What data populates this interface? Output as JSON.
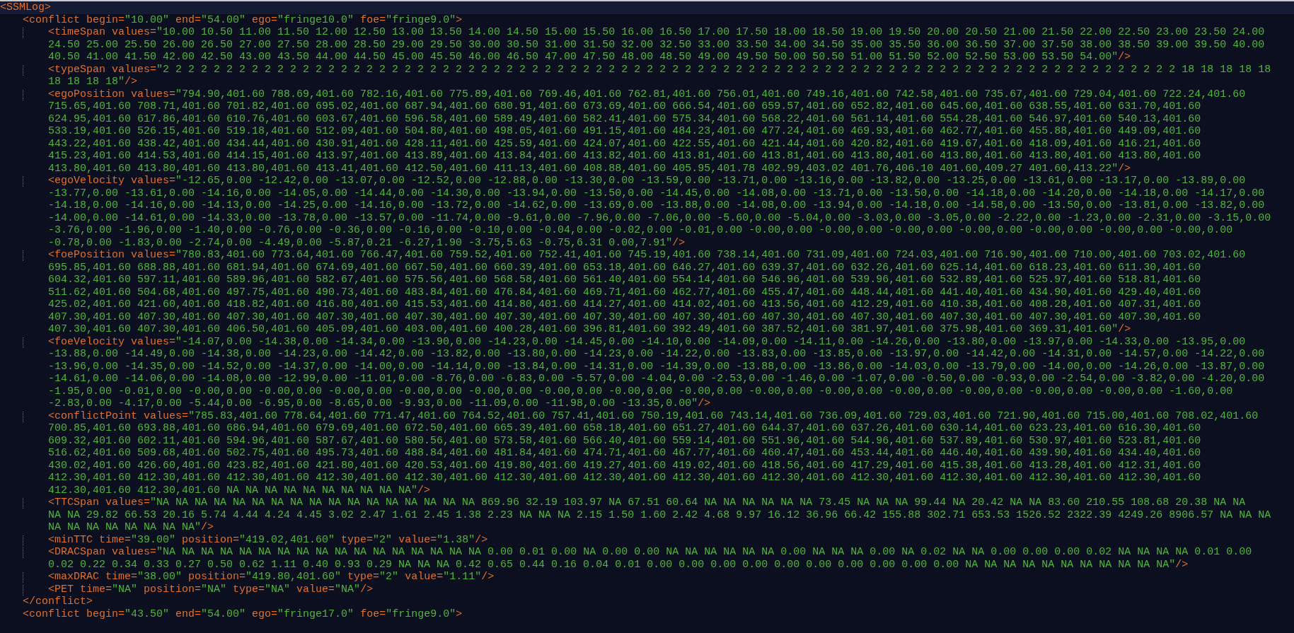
{
  "editor": {
    "root": {
      "current": true,
      "open": [
        {
          "kind": "tag",
          "text": "<SSMLog>"
        }
      ],
      "conflicts": [
        {
          "open": [
            {
              "kind": "tag",
              "text": "<conflict begin="
            },
            {
              "kind": "value",
              "text": "\"10.00\""
            },
            {
              "kind": "tag",
              "text": " end="
            },
            {
              "kind": "value",
              "text": "\"54.00\""
            },
            {
              "kind": "tag",
              "text": " ego="
            },
            {
              "kind": "value",
              "text": "\"fringe10.0\""
            },
            {
              "kind": "tag",
              "text": " foe="
            },
            {
              "kind": "value",
              "text": "\"fringe9.0\""
            },
            {
              "kind": "tag",
              "text": ">"
            }
          ],
          "elements": [
            {
              "lines": [
                [
                  {
                    "kind": "tag",
                    "text": "<timeSpan values="
                  },
                  {
                    "kind": "value",
                    "text": "\"10.00 10.50 11.00 11.50 12.00 12.50 13.00 13.50 14.00 14.50 15.00 15.50 16.00 16.50 17.00 17.50 18.00 18.50 19.00 19.50 20.00 20.50 21.00 21.50 22.00 22.50 23.00 23.50 24.00"
                  }
                ],
                [
                  {
                    "kind": "value",
                    "text": "24.50 25.00 25.50 26.00 26.50 27.00 27.50 28.00 28.50 29.00 29.50 30.00 30.50 31.00 31.50 32.00 32.50 33.00 33.50 34.00 34.50 35.00 35.50 36.00 36.50 37.00 37.50 38.00 38.50 39.00 39.50 40.00"
                  }
                ],
                [
                  {
                    "kind": "value",
                    "text": "40.50 41.00 41.50 42.00 42.50 43.00 43.50 44.00 44.50 45.00 45.50 46.00 46.50 47.00 47.50 48.00 48.50 49.00 49.50 50.00 50.50 51.00 51.50 52.00 52.50 53.00 53.50 54.00\""
                  },
                  {
                    "kind": "tag",
                    "text": "/>"
                  }
                ]
              ]
            },
            {
              "lines": [
                [
                  {
                    "kind": "tag",
                    "text": "<typeSpan values="
                  },
                  {
                    "kind": "value",
                    "text": "\"2 2 2 2 2 2 2 2 2 2 2 2 2 2 2 2 2 2 2 2 2 2 2 2 2 2 2 2 2 2 2 2 2 2 2 2 2 2 2 2 2 2 2 2 2 2 2 2 2 2 2 2 2 2 2 2 2 2 2 2 2 2 2 2 2 2 2 2 2 2 2 2 2 2 2 2 2 2 2 2 18 18 18 18 18"
                  }
                ],
                [
                  {
                    "kind": "value",
                    "text": "18 18 18 18\""
                  },
                  {
                    "kind": "tag",
                    "text": "/>"
                  }
                ]
              ]
            },
            {
              "lines": [
                [
                  {
                    "kind": "tag",
                    "text": "<egoPosition values="
                  },
                  {
                    "kind": "value",
                    "text": "\"794.90,401.60 788.69,401.60 782.16,401.60 775.89,401.60 769.46,401.60 762.81,401.60 756.01,401.60 749.16,401.60 742.58,401.60 735.67,401.60 729.04,401.60 722.24,401.60"
                  }
                ],
                [
                  {
                    "kind": "value",
                    "text": "715.65,401.60 708.71,401.60 701.82,401.60 695.02,401.60 687.94,401.60 680.91,401.60 673.69,401.60 666.54,401.60 659.57,401.60 652.82,401.60 645.60,401.60 638.55,401.60 631.70,401.60"
                  }
                ],
                [
                  {
                    "kind": "value",
                    "text": "624.95,401.60 617.86,401.60 610.76,401.60 603.67,401.60 596.58,401.60 589.49,401.60 582.41,401.60 575.34,401.60 568.22,401.60 561.14,401.60 554.28,401.60 546.97,401.60 540.13,401.60"
                  }
                ],
                [
                  {
                    "kind": "value",
                    "text": "533.19,401.60 526.15,401.60 519.18,401.60 512.09,401.60 504.80,401.60 498.05,401.60 491.15,401.60 484.23,401.60 477.24,401.60 469.93,401.60 462.77,401.60 455.88,401.60 449.09,401.60"
                  }
                ],
                [
                  {
                    "kind": "value",
                    "text": "443.22,401.60 438.42,401.60 434.44,401.60 430.91,401.60 428.11,401.60 425.59,401.60 424.07,401.60 422.55,401.60 421.44,401.60 420.82,401.60 419.67,401.60 418.09,401.60 416.21,401.60"
                  }
                ],
                [
                  {
                    "kind": "value",
                    "text": "415.23,401.60 414.53,401.60 414.15,401.60 413.97,401.60 413.89,401.60 413.84,401.60 413.82,401.60 413.81,401.60 413.81,401.60 413.80,401.60 413.80,401.60 413.80,401.60 413.80,401.60"
                  }
                ],
                [
                  {
                    "kind": "value",
                    "text": "413.80,401.60 413.80,401.60 413.80,401.60 413.41,401.60 412.50,401.60 411.13,401.60 408.88,401.60 405.95,401.78 402.99,403.02 401.76,406.10 401.60,409.27 401.60,413.22\""
                  },
                  {
                    "kind": "tag",
                    "text": "/>"
                  }
                ]
              ]
            },
            {
              "lines": [
                [
                  {
                    "kind": "tag",
                    "text": "<egoVelocity values="
                  },
                  {
                    "kind": "value",
                    "text": "\"-12.65,0.00 -12.42,0.00 -13.07,0.00 -12.52,0.00 -12.88,0.00 -13.30,0.00 -13.59,0.00 -13.71,0.00 -13.16,0.00 -13.82,0.00 -13.25,0.00 -13.61,0.00 -13.17,0.00 -13.89,0.00"
                  }
                ],
                [
                  {
                    "kind": "value",
                    "text": "-13.77,0.00 -13.61,0.00 -14.16,0.00 -14.05,0.00 -14.44,0.00 -14.30,0.00 -13.94,0.00 -13.50,0.00 -14.45,0.00 -14.08,0.00 -13.71,0.00 -13.50,0.00 -14.18,0.00 -14.20,0.00 -14.18,0.00 -14.17,0.00"
                  }
                ],
                [
                  {
                    "kind": "value",
                    "text": "-14.18,0.00 -14.16,0.00 -14.13,0.00 -14.25,0.00 -14.16,0.00 -13.72,0.00 -14.62,0.00 -13.69,0.00 -13.88,0.00 -14.08,0.00 -13.94,0.00 -14.18,0.00 -14.58,0.00 -13.50,0.00 -13.81,0.00 -13.82,0.00"
                  }
                ],
                [
                  {
                    "kind": "value",
                    "text": "-14.00,0.00 -14.61,0.00 -14.33,0.00 -13.78,0.00 -13.57,0.00 -11.74,0.00 -9.61,0.00 -7.96,0.00 -7.06,0.00 -5.60,0.00 -5.04,0.00 -3.03,0.00 -3.05,0.00 -2.22,0.00 -1.23,0.00 -2.31,0.00 -3.15,0.00"
                  }
                ],
                [
                  {
                    "kind": "value",
                    "text": "-3.76,0.00 -1.96,0.00 -1.40,0.00 -0.76,0.00 -0.36,0.00 -0.16,0.00 -0.10,0.00 -0.04,0.00 -0.02,0.00 -0.01,0.00 -0.00,0.00 -0.00,0.00 -0.00,0.00 -0.00,0.00 -0.00,0.00 -0.00,0.00 -0.00,0.00"
                  }
                ],
                [
                  {
                    "kind": "value",
                    "text": "-0.78,0.00 -1.83,0.00 -2.74,0.00 -4.49,0.00 -5.87,0.21 -6.27,1.90 -3.75,5.63 -0.75,6.31 0.00,7.91\""
                  },
                  {
                    "kind": "tag",
                    "text": "/>"
                  }
                ]
              ]
            },
            {
              "lines": [
                [
                  {
                    "kind": "tag",
                    "text": "<foePosition values="
                  },
                  {
                    "kind": "value",
                    "text": "\"780.83,401.60 773.64,401.60 766.47,401.60 759.52,401.60 752.41,401.60 745.19,401.60 738.14,401.60 731.09,401.60 724.03,401.60 716.90,401.60 710.00,401.60 703.02,401.60"
                  }
                ],
                [
                  {
                    "kind": "value",
                    "text": "695.85,401.60 688.88,401.60 681.94,401.60 674.69,401.60 667.50,401.60 660.39,401.60 653.18,401.60 646.27,401.60 639.37,401.60 632.26,401.60 625.14,401.60 618.23,401.60 611.30,401.60"
                  }
                ],
                [
                  {
                    "kind": "value",
                    "text": "604.32,401.60 597.11,401.60 589.96,401.60 582.67,401.60 575.56,401.60 568.58,401.60 561.40,401.60 554.14,401.60 546.96,401.60 539.96,401.60 532.89,401.60 525.97,401.60 518.81,401.60"
                  }
                ],
                [
                  {
                    "kind": "value",
                    "text": "511.62,401.60 504.68,401.60 497.75,401.60 490.73,401.60 483.84,401.60 476.84,401.60 469.71,401.60 462.77,401.60 455.47,401.60 448.44,401.60 441.40,401.60 434.90,401.60 429.40,401.60"
                  }
                ],
                [
                  {
                    "kind": "value",
                    "text": "425.02,401.60 421.60,401.60 418.82,401.60 416.80,401.60 415.53,401.60 414.80,401.60 414.27,401.60 414.02,401.60 413.56,401.60 412.29,401.60 410.38,401.60 408.28,401.60 407.31,401.60"
                  }
                ],
                [
                  {
                    "kind": "value",
                    "text": "407.30,401.60 407.30,401.60 407.30,401.60 407.30,401.60 407.30,401.60 407.30,401.60 407.30,401.60 407.30,401.60 407.30,401.60 407.30,401.60 407.30,401.60 407.30,401.60 407.30,401.60"
                  }
                ],
                [
                  {
                    "kind": "value",
                    "text": "407.30,401.60 407.30,401.60 406.50,401.60 405.09,401.60 403.00,401.60 400.28,401.60 396.81,401.60 392.49,401.60 387.52,401.60 381.97,401.60 375.98,401.60 369.31,401.60\""
                  },
                  {
                    "kind": "tag",
                    "text": "/>"
                  }
                ]
              ]
            },
            {
              "lines": [
                [
                  {
                    "kind": "tag",
                    "text": "<foeVelocity values="
                  },
                  {
                    "kind": "value",
                    "text": "\"-14.07,0.00 -14.38,0.00 -14.34,0.00 -13.90,0.00 -14.23,0.00 -14.45,0.00 -14.10,0.00 -14.09,0.00 -14.11,0.00 -14.26,0.00 -13.80,0.00 -13.97,0.00 -14.33,0.00 -13.95,0.00"
                  }
                ],
                [
                  {
                    "kind": "value",
                    "text": "-13.88,0.00 -14.49,0.00 -14.38,0.00 -14.23,0.00 -14.42,0.00 -13.82,0.00 -13.80,0.00 -14.23,0.00 -14.22,0.00 -13.83,0.00 -13.85,0.00 -13.97,0.00 -14.42,0.00 -14.31,0.00 -14.57,0.00 -14.22,0.00"
                  }
                ],
                [
                  {
                    "kind": "value",
                    "text": "-13.96,0.00 -14.35,0.00 -14.52,0.00 -14.37,0.00 -14.00,0.00 -14.14,0.00 -13.84,0.00 -14.31,0.00 -14.39,0.00 -13.88,0.00 -13.86,0.00 -14.03,0.00 -13.79,0.00 -14.00,0.00 -14.26,0.00 -13.87,0.00"
                  }
                ],
                [
                  {
                    "kind": "value",
                    "text": "-14.61,0.00 -14.06,0.00 -14.08,0.00 -12.99,0.00 -11.01,0.00 -8.76,0.00 -6.83,0.00 -5.57,0.00 -4.04,0.00 -2.53,0.00 -1.46,0.00 -1.07,0.00 -0.50,0.00 -0.93,0.00 -2.54,0.00 -3.82,0.00 -4.20,0.00"
                  }
                ],
                [
                  {
                    "kind": "value",
                    "text": "-1.95,0.00 -0.01,0.00 -0.00,0.00 -0.00,0.00 -0.00,0.00 -0.00,0.00 -0.00,0.00 -0.00,0.00 -0.00,0.00 -0.00,0.00 -0.00,0.00 -0.00,0.00 -0.00,0.00 -0.00,0.00 -0.00,0.00 -0.00,0.00 -1.60,0.00"
                  }
                ],
                [
                  {
                    "kind": "value",
                    "text": "-2.83,0.00 -4.17,0.00 -5.44,0.00 -6.95,0.00 -8.65,0.00 -9.93,0.00 -11.09,0.00 -11.98,0.00 -13.35,0.00\""
                  },
                  {
                    "kind": "tag",
                    "text": "/>"
                  }
                ]
              ]
            },
            {
              "lines": [
                [
                  {
                    "kind": "tag",
                    "text": "<conflictPoint values="
                  },
                  {
                    "kind": "value",
                    "text": "\"785.83,401.60 778.64,401.60 771.47,401.60 764.52,401.60 757.41,401.60 750.19,401.60 743.14,401.60 736.09,401.60 729.03,401.60 721.90,401.60 715.00,401.60 708.02,401.60"
                  }
                ],
                [
                  {
                    "kind": "value",
                    "text": "700.85,401.60 693.88,401.60 686.94,401.60 679.69,401.60 672.50,401.60 665.39,401.60 658.18,401.60 651.27,401.60 644.37,401.60 637.26,401.60 630.14,401.60 623.23,401.60 616.30,401.60"
                  }
                ],
                [
                  {
                    "kind": "value",
                    "text": "609.32,401.60 602.11,401.60 594.96,401.60 587.67,401.60 580.56,401.60 573.58,401.60 566.40,401.60 559.14,401.60 551.96,401.60 544.96,401.60 537.89,401.60 530.97,401.60 523.81,401.60"
                  }
                ],
                [
                  {
                    "kind": "value",
                    "text": "516.62,401.60 509.68,401.60 502.75,401.60 495.73,401.60 488.84,401.60 481.84,401.60 474.71,401.60 467.77,401.60 460.47,401.60 453.44,401.60 446.40,401.60 439.90,401.60 434.40,401.60"
                  }
                ],
                [
                  {
                    "kind": "value",
                    "text": "430.02,401.60 426.60,401.60 423.82,401.60 421.80,401.60 420.53,401.60 419.80,401.60 419.27,401.60 419.02,401.60 418.56,401.60 417.29,401.60 415.38,401.60 413.28,401.60 412.31,401.60"
                  }
                ],
                [
                  {
                    "kind": "value",
                    "text": "412.30,401.60 412.30,401.60 412.30,401.60 412.30,401.60 412.30,401.60 412.30,401.60 412.30,401.60 412.30,401.60 412.30,401.60 412.30,401.60 412.30,401.60 412.30,401.60 412.30,401.60"
                  }
                ],
                [
                  {
                    "kind": "value",
                    "text": "412.30,401.60 412.30,401.60 NA NA NA NA NA NA NA NA NA NA\""
                  },
                  {
                    "kind": "tag",
                    "text": "/>"
                  }
                ]
              ]
            },
            {
              "lines": [
                [
                  {
                    "kind": "tag",
                    "text": "<TTCSpan values="
                  },
                  {
                    "kind": "value",
                    "text": "\"NA NA NA NA NA NA NA NA NA NA NA NA NA NA NA NA NA 869.96 32.19 103.97 NA 67.51 60.64 NA NA NA NA NA NA 73.45 NA NA NA 99.44 NA 20.42 NA NA 83.60 210.55 108.68 20.38 NA NA"
                  }
                ],
                [
                  {
                    "kind": "value",
                    "text": "NA NA 29.82 66.53 20.16 5.74 4.44 4.24 4.45 3.02 2.47 1.61 2.45 1.38 2.23 NA NA NA 2.15 1.50 1.60 2.42 4.68 9.97 16.12 36.96 66.42 155.88 302.71 653.53 1526.52 2322.39 4249.26 8906.57 NA NA NA"
                  }
                ],
                [
                  {
                    "kind": "value",
                    "text": "NA NA NA NA NA NA NA NA\""
                  },
                  {
                    "kind": "tag",
                    "text": "/>"
                  }
                ]
              ]
            },
            {
              "lines": [
                [
                  {
                    "kind": "tag",
                    "text": "<minTTC time="
                  },
                  {
                    "kind": "value",
                    "text": "\"39.00\""
                  },
                  {
                    "kind": "tag",
                    "text": " position="
                  },
                  {
                    "kind": "value",
                    "text": "\"419.02,401.60\""
                  },
                  {
                    "kind": "tag",
                    "text": " type="
                  },
                  {
                    "kind": "value",
                    "text": "\"2\""
                  },
                  {
                    "kind": "tag",
                    "text": " value="
                  },
                  {
                    "kind": "value",
                    "text": "\"1.38\""
                  },
                  {
                    "kind": "tag",
                    "text": "/>"
                  }
                ]
              ]
            },
            {
              "lines": [
                [
                  {
                    "kind": "tag",
                    "text": "<DRACSpan values="
                  },
                  {
                    "kind": "value",
                    "text": "\"NA NA NA NA NA NA NA NA NA NA NA NA NA NA NA NA NA 0.00 0.01 0.00 NA 0.00 0.00 NA NA NA NA NA NA 0.00 NA NA NA 0.00 NA 0.02 NA NA 0.00 0.00 0.00 0.02 NA NA NA NA 0.01 0.00"
                  }
                ],
                [
                  {
                    "kind": "value",
                    "text": "0.02 0.22 0.34 0.33 0.27 0.50 0.62 1.11 0.40 0.93 0.29 NA NA NA 0.42 0.65 0.44 0.16 0.04 0.01 0.00 0.00 0.00 0.00 0.00 0.00 0.00 0.00 0.00 0.00 NA NA NA NA NA NA NA NA NA NA NA\""
                  },
                  {
                    "kind": "tag",
                    "text": "/>"
                  }
                ]
              ]
            },
            {
              "lines": [
                [
                  {
                    "kind": "tag",
                    "text": "<maxDRAC time="
                  },
                  {
                    "kind": "value",
                    "text": "\"38.00\""
                  },
                  {
                    "kind": "tag",
                    "text": " position="
                  },
                  {
                    "kind": "value",
                    "text": "\"419.80,401.60\""
                  },
                  {
                    "kind": "tag",
                    "text": " type="
                  },
                  {
                    "kind": "value",
                    "text": "\"2\""
                  },
                  {
                    "kind": "tag",
                    "text": " value="
                  },
                  {
                    "kind": "value",
                    "text": "\"1.11\""
                  },
                  {
                    "kind": "tag",
                    "text": "/>"
                  }
                ]
              ]
            },
            {
              "lines": [
                [
                  {
                    "kind": "tag",
                    "text": "<PET time="
                  },
                  {
                    "kind": "value",
                    "text": "\"NA\""
                  },
                  {
                    "kind": "tag",
                    "text": " position="
                  },
                  {
                    "kind": "value",
                    "text": "\"NA\""
                  },
                  {
                    "kind": "tag",
                    "text": " type="
                  },
                  {
                    "kind": "value",
                    "text": "\"NA\""
                  },
                  {
                    "kind": "tag",
                    "text": " value="
                  },
                  {
                    "kind": "value",
                    "text": "\"NA\""
                  },
                  {
                    "kind": "tag",
                    "text": "/>"
                  }
                ]
              ]
            }
          ],
          "close": [
            {
              "kind": "tag",
              "text": "</conflict>"
            }
          ]
        },
        {
          "open": [
            {
              "kind": "tag",
              "text": "<conflict begin="
            },
            {
              "kind": "value",
              "text": "\"43.50\""
            },
            {
              "kind": "tag",
              "text": " end="
            },
            {
              "kind": "value",
              "text": "\"54.00\""
            },
            {
              "kind": "tag",
              "text": " ego="
            },
            {
              "kind": "value",
              "text": "\"fringe17.0\""
            },
            {
              "kind": "tag",
              "text": " foe="
            },
            {
              "kind": "value",
              "text": "\"fringe9.0\""
            },
            {
              "kind": "tag",
              "text": ">"
            }
          ]
        }
      ]
    }
  }
}
